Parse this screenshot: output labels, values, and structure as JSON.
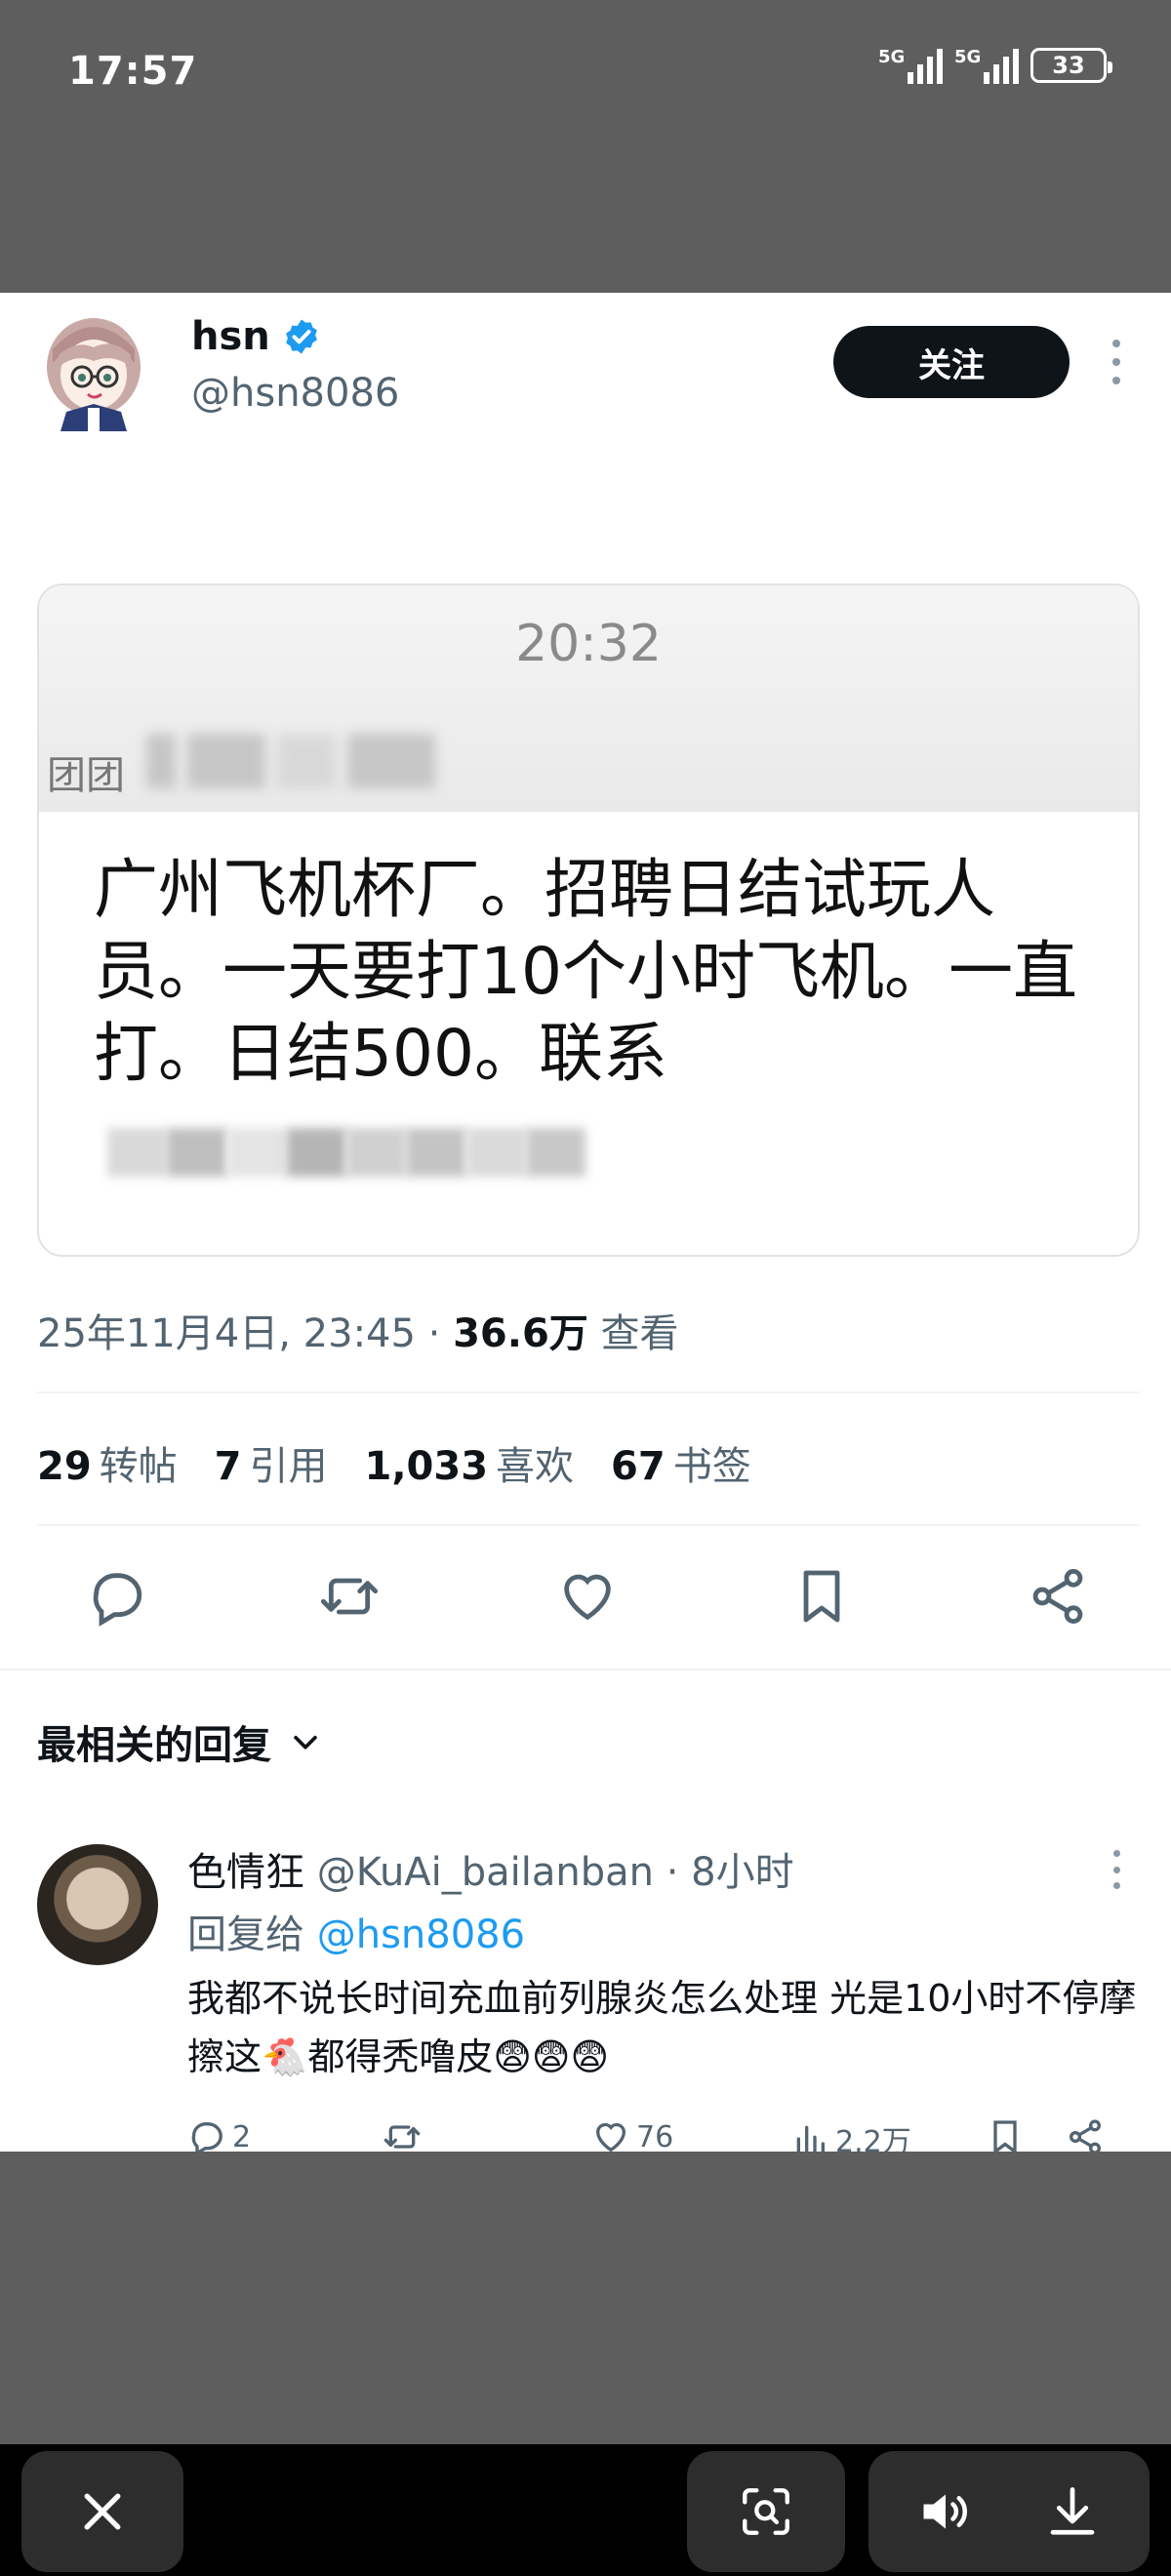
{
  "status_bar": {
    "time": "17:57",
    "signal_1_label": "5G",
    "signal_2_label": "5G",
    "battery": "33"
  },
  "post": {
    "display_name": "hsn",
    "handle": "@hsn8086",
    "follow_label": "关注",
    "embed": {
      "time": "20:32",
      "sender": "团团",
      "message": "广州飞机杯厂。招聘日结试玩人员。一天要打10个小时飞机。一直打。日结500。联系"
    },
    "meta": {
      "datetime": "25年11月4日, 23:45 · ",
      "views_count": "36.6万",
      "views_label": " 查看"
    },
    "stats": {
      "reposts_count": "29",
      "reposts_label": "转帖",
      "quotes_count": "7",
      "quotes_label": "引用",
      "likes_count": "1,033",
      "likes_label": "喜欢",
      "bookmarks_count": "67",
      "bookmarks_label": "书签"
    }
  },
  "replies_section": {
    "sort_label": "最相关的回复"
  },
  "reply": {
    "name": "色情狂",
    "handle_time": " @KuAi_bailanban · 8小时",
    "reply_to_prefix": "回复给 ",
    "reply_to_handle": "@hsn8086",
    "text": "我都不说长时间充血前列腺炎怎么处理  光是10小时不停摩擦这🐔都得秃噜皮😨😨😨",
    "replies": "2",
    "likes": "76",
    "views": "2.2万"
  },
  "colors": {
    "accent": "#1d9bf0",
    "text": "#0f1419",
    "secondary": "#536471",
    "overlay": "#5e5e5e"
  },
  "icons": {
    "verified": "verified-badge-icon",
    "reply": "reply-icon",
    "repost": "repost-icon",
    "like": "heart-icon",
    "bookmark": "bookmark-icon",
    "share": "share-icon",
    "close": "close-icon",
    "lens": "lens-search-icon",
    "speaker": "speaker-icon",
    "download": "download-icon"
  }
}
